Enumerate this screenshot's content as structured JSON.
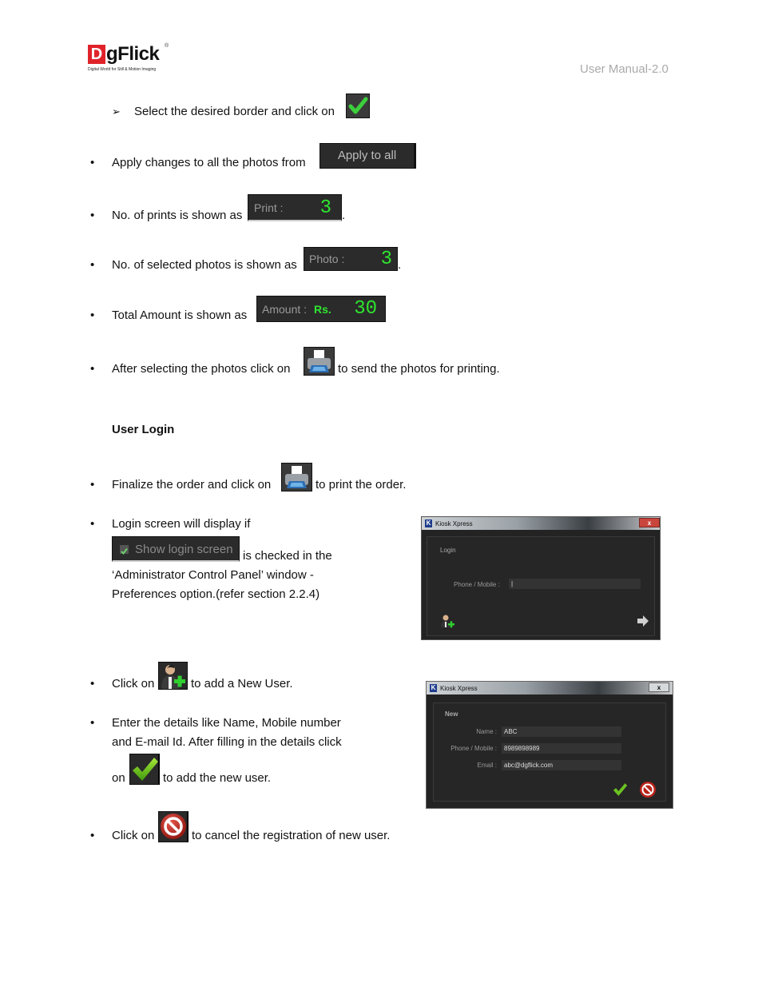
{
  "header": {
    "brand_initial": "D",
    "brand_rest": "gFlick",
    "brand_tagline": "Digital World for Still & Motion Imaging",
    "brand_registered": "®",
    "doc_label": "User Manual-2.0"
  },
  "bullets": {
    "select_border": {
      "marker": "➢",
      "text": "Select the desired border and click on"
    },
    "apply_all": {
      "marker": "•",
      "text": "Apply changes to all the photos from",
      "button_label": "Apply to all"
    },
    "prints": {
      "marker": "•",
      "text": "No. of prints is shown as",
      "suffix": ".",
      "counter_label": "Print :",
      "counter_value": "3"
    },
    "photos": {
      "marker": "•",
      "text": "No. of selected photos is shown as",
      "suffix": ".",
      "counter_label": "Photo :",
      "counter_value": "3"
    },
    "amount": {
      "marker": "•",
      "text": "Total Amount is shown as",
      "counter_label": "Amount :",
      "currency": "Rs.",
      "counter_value": "30"
    },
    "send_print": {
      "marker": "•",
      "before": "After selecting the photos click on",
      "after": "to send the photos for printing."
    }
  },
  "section": {
    "title": "User Login"
  },
  "login_bullets": {
    "finalize": {
      "marker": "•",
      "before": "Finalize the order and click on",
      "after": "to print the order."
    },
    "login_screen": {
      "marker": "•",
      "line1": "Login screen will display if",
      "checkbox_label": "Show login screen",
      "checkbox_checked": true,
      "line2_after": "is checked in the",
      "line3": "‘Administrator Control Panel’ window -",
      "line4": "Preferences option.(refer section 2.2.4)"
    },
    "add_user": {
      "marker": "•",
      "before": "Click on",
      "after": "to add a New User."
    },
    "enter_details": {
      "marker": "•",
      "line1": "Enter the details like Name, Mobile number",
      "line2": "and E-mail Id. After filling in the details click",
      "line3_before": "on",
      "line3_after": "to add the new user."
    },
    "cancel": {
      "marker": "•",
      "before": "Click on",
      "after": "to cancel the registration of new user."
    }
  },
  "login_window": {
    "app_icon": "K",
    "title": "Kiosk Xpress",
    "close": "x",
    "heading": "Login",
    "phone_label": "Phone / Mobile :",
    "phone_value": "|"
  },
  "new_user_window": {
    "app_icon": "K",
    "title": "Kiosk Xpress",
    "close": "x",
    "heading": "New",
    "fields": [
      {
        "label": "Name :",
        "value": "ABC"
      },
      {
        "label": "Phone / Mobile :",
        "value": "8989898989"
      },
      {
        "label": "Email :",
        "value": "abc@dgflick.com"
      }
    ]
  },
  "colors": {
    "brand_red": "#e0232a",
    "lcd_green": "#2ee52e",
    "ok_green": "#5fc21a",
    "cancel_red": "#b8231b",
    "dark_ui": "#2b2b2b"
  }
}
